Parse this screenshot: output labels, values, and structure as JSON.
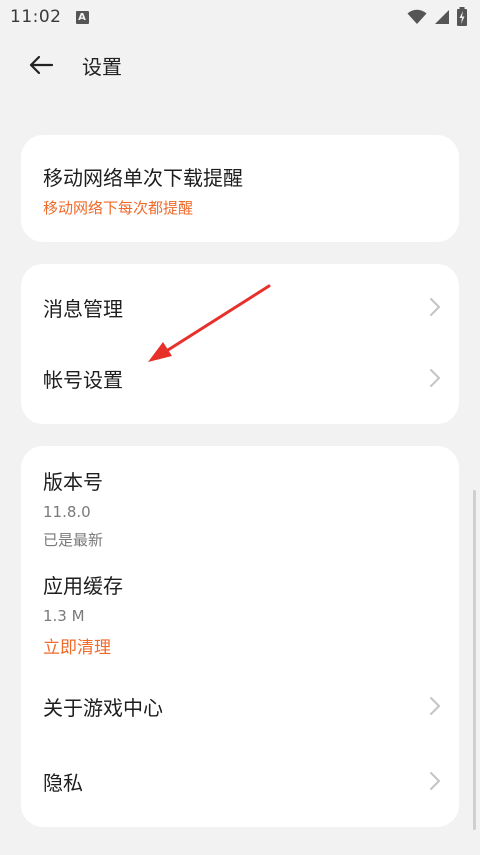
{
  "status_bar": {
    "time": "11:02",
    "notification_badge": "A",
    "icons": [
      "wifi-icon",
      "signal-icon",
      "battery-charging-icon"
    ]
  },
  "header": {
    "title": "设置",
    "back_icon": "back-arrow-icon"
  },
  "card1": {
    "title": "移动网络单次下载提醒",
    "subtitle": "移动网络下每次都提醒"
  },
  "card2": {
    "items": [
      {
        "label": "消息管理",
        "icon": "chevron-right-icon"
      },
      {
        "label": "帐号设置",
        "icon": "chevron-right-icon"
      }
    ]
  },
  "card3": {
    "version": {
      "title": "版本号",
      "value": "11.8.0",
      "status": "已是最新"
    },
    "cache": {
      "title": "应用缓存",
      "size": "1.3 M",
      "action": "立即清理"
    },
    "items": [
      {
        "label": "关于游戏中心",
        "icon": "chevron-right-icon"
      },
      {
        "label": "隐私",
        "icon": "chevron-right-icon"
      }
    ]
  },
  "colors": {
    "accent": "#f06a2a",
    "annotation_arrow": "#e8302a",
    "background": "#f2f2f2",
    "card": "#ffffff"
  }
}
